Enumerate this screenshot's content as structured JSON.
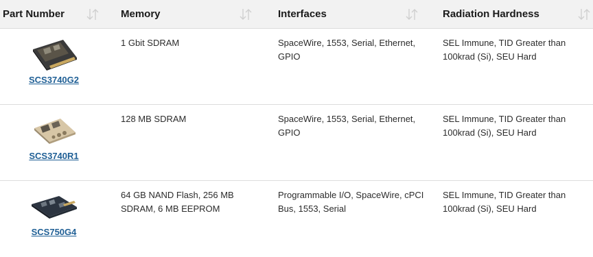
{
  "table": {
    "headers": [
      "Part Number",
      "Memory",
      "Interfaces",
      "Radiation Hardness"
    ],
    "rows": [
      {
        "part": "SCS3740G2",
        "image_icon": "circuit-board-image",
        "memory": "1 Gbit SDRAM",
        "interfaces": "SpaceWire, 1553, Serial, Ethernet, GPIO",
        "radiation": "SEL Immune, TID Greater than 100krad (Si), SEU Hard"
      },
      {
        "part": "SCS3740R1",
        "image_icon": "circuit-board-image",
        "memory": "128 MB SDRAM",
        "interfaces": "SpaceWire, 1553, Serial, Ethernet, GPIO",
        "radiation": "SEL Immune, TID Greater than 100krad (Si), SEU Hard"
      },
      {
        "part": "SCS750G4",
        "image_icon": "circuit-board-image",
        "memory": "64 GB NAND Flash, 256 MB SDRAM, 6 MB EEPROM",
        "interfaces": "Programmable I/O, SpaceWire, cPCI Bus, 1553, Serial",
        "radiation": "SEL Immune, TID Greater than 100krad (Si), SEU Hard"
      }
    ],
    "sort_icon": "sort-arrows-icon",
    "colors": {
      "header_bg": "#f2f2f2",
      "link": "#1f5f95",
      "divider": "#dcdcdc"
    }
  }
}
